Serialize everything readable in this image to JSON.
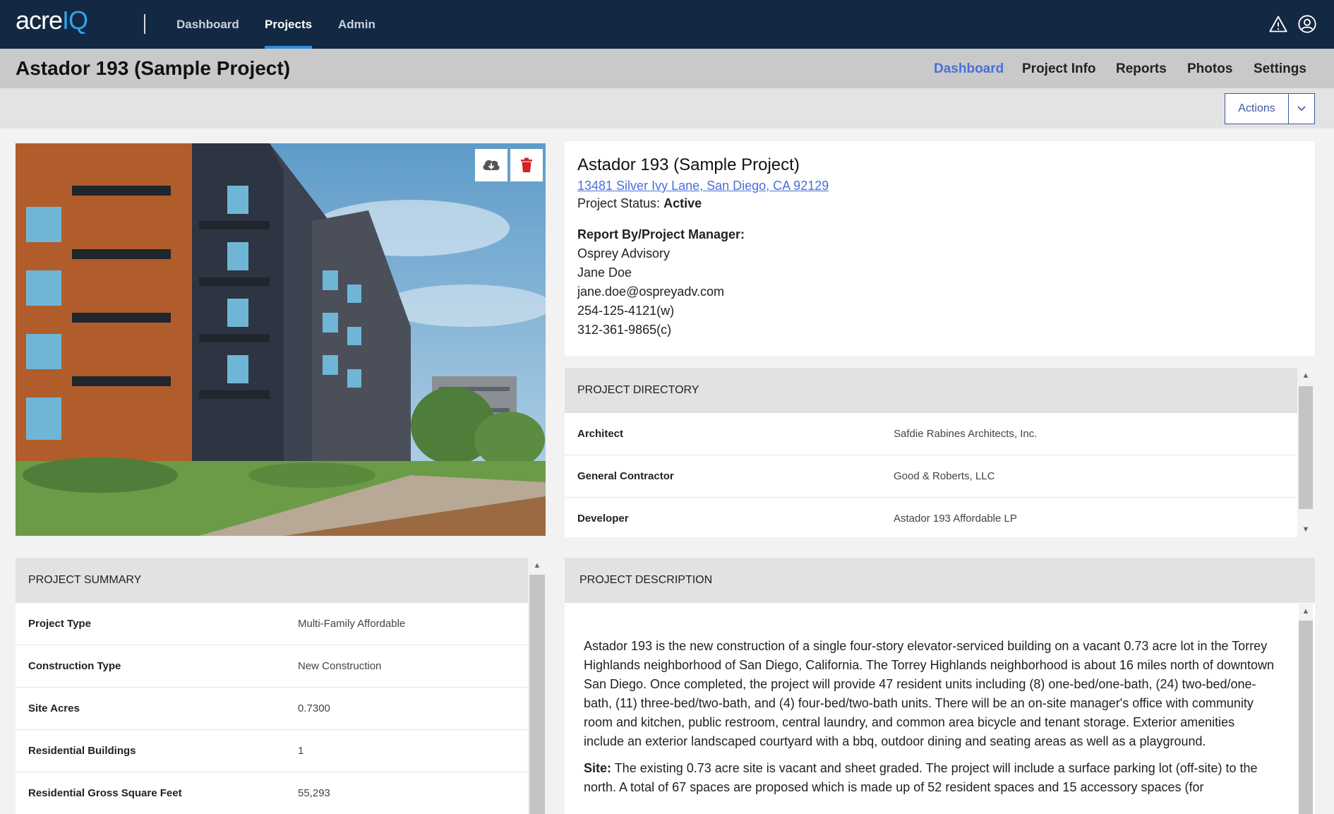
{
  "app": {
    "logo_part1": "acre",
    "logo_part2": "IQ",
    "nav": [
      "Dashboard",
      "Projects",
      "Admin"
    ],
    "active_nav": "Projects",
    "icons": [
      "warning-icon",
      "user-account-icon"
    ]
  },
  "header": {
    "title": "Astador 193 (Sample Project)",
    "tabs": [
      "Dashboard",
      "Project Info",
      "Reports",
      "Photos",
      "Settings"
    ],
    "active_tab": "Dashboard"
  },
  "actionbar": {
    "actions_label": "Actions"
  },
  "photo": {
    "tools": [
      "cloud-download-icon",
      "trash-icon"
    ]
  },
  "info": {
    "title": "Astador 193 (Sample Project)",
    "address": "13481 Silver Ivy Lane, San Diego, CA 92129",
    "status_label": "Project Status:",
    "status_value": "Active",
    "manager_heading": "Report By/Project Manager:",
    "company": "Osprey Advisory",
    "name": "Jane Doe",
    "email": "jane.doe@ospreyadv.com",
    "phone_work": "254-125-4121(w)",
    "phone_cell": "312-361-9865(c)"
  },
  "directory": {
    "heading": "PROJECT DIRECTORY",
    "rows": [
      {
        "k": "Architect",
        "v": "Safdie Rabines Architects, Inc."
      },
      {
        "k": "General Contractor",
        "v": "Good & Roberts, LLC"
      },
      {
        "k": "Developer",
        "v": "Astador 193 Affordable LP"
      }
    ]
  },
  "summary": {
    "heading": "PROJECT SUMMARY",
    "rows": [
      {
        "k": "Project Type",
        "v": "Multi-Family Affordable"
      },
      {
        "k": "Construction Type",
        "v": "New Construction"
      },
      {
        "k": "Site Acres",
        "v": "0.7300"
      },
      {
        "k": "Residential Buildings",
        "v": "1"
      },
      {
        "k": "Residential Gross Square Feet",
        "v": "55,293"
      }
    ]
  },
  "description": {
    "heading": "PROJECT DESCRIPTION",
    "para1": "Astador 193 is the new construction of a single four-story elevator-serviced building on a vacant 0.73 acre lot in the Torrey Highlands neighborhood of San Diego, California.  The Torrey Highlands neighborhood is about 16 miles north of downtown San Diego.  Once completed, the project will provide 47 resident units including (8) one-bed/one-bath, (24) two-bed/one-bath, (11) three-bed/two-bath, and (4) four-bed/two-bath units.  There will be an on-site manager's office with community room and kitchen, public restroom, central laundry, and common area bicycle and tenant storage.  Exterior amenities include an exterior landscaped courtyard with a bbq, outdoor dining and seating areas as well as a playground.",
    "site_label": "Site:",
    "site_text": " The existing 0.73 acre site is vacant and sheet graded.  The project will include a surface parking lot (off-site) to the north.  A total of 67 spaces are proposed which is made up of 52 resident spaces and 15 accessory spaces (for"
  }
}
